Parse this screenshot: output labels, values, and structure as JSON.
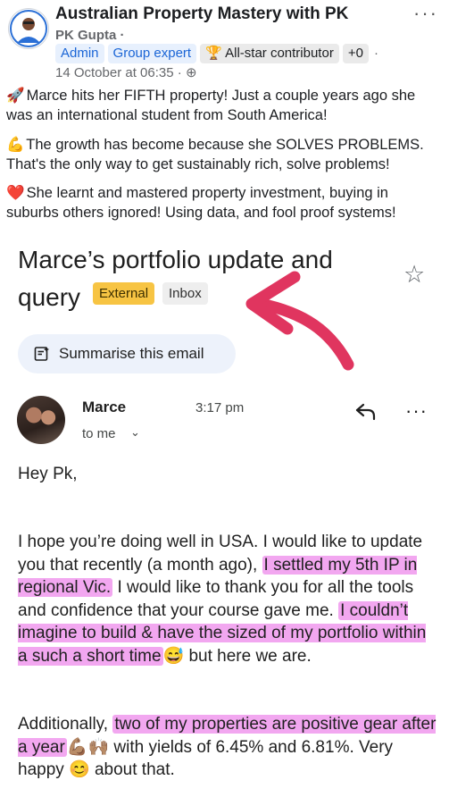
{
  "post": {
    "group_name": "Australian Property Mastery with PK",
    "author": "PK Gupta",
    "author_sep": "·",
    "badges": [
      "Admin",
      "Group expert",
      "All-star contributor",
      "+0",
      "·"
    ],
    "date": "14 October at 06:35 ·",
    "paragraphs": [
      {
        "emoji": "🚀",
        "text": "Marce hits her FIFTH property! Just a couple years ago she was an international student from South America!"
      },
      {
        "emoji": "💪",
        "text": "The growth has become because she SOLVES PROBLEMS. That's the only way to get sustainably rich, solve problems!"
      },
      {
        "emoji": "❤️",
        "text": "She learnt and mastered property investment, buying in suburbs others ignored! Using data, and fool proof systems!"
      }
    ]
  },
  "email": {
    "subject": "Marce’s portfolio update and query",
    "label_external": "External",
    "label_inbox": "Inbox",
    "summarise_label": "Summarise this email",
    "sender": "Marce",
    "time": "3:17 pm",
    "to": "to me",
    "greeting": "Hey Pk,",
    "p1": {
      "a": "I hope you’re doing well in USA. I would like to update you that recently (a month ago), ",
      "hl1": "I settled my 5th IP in regional Vic.",
      "b": " I would like to thank you for all the tools and confidence that your course gave me. ",
      "hl2": "I couldn’t imagine to build & have the sized of my portfolio within a such a short time",
      "c": "😅 but here we are."
    },
    "p2": {
      "a": "Additionally, ",
      "hl": "two of my properties are positive gear after a year",
      "b": "💪🏽🙌🏽 with yields of 6.45% and 6.81%. Very happy 😊 about that."
    }
  },
  "colors": {
    "highlight": "#f2a7f0",
    "arrow": "#e0355f",
    "external_label": "#f7c443",
    "badge_blue": "#1a65d6"
  },
  "icons": [
    "trophy-icon",
    "globe-icon",
    "star-icon",
    "summarise-icon",
    "reply-icon",
    "more-icon",
    "chevron-down-icon",
    "arrow-annotation"
  ]
}
